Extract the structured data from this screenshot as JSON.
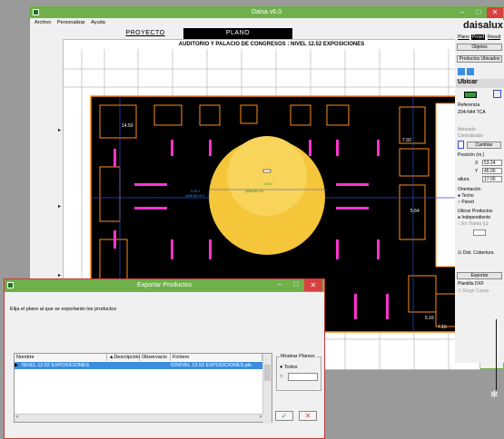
{
  "window": {
    "title": "Daisa v6.0",
    "menu": [
      "Archivo",
      "Personalizar",
      "Ayuda"
    ],
    "tabs": [
      "PROYECTO",
      "PLANO"
    ]
  },
  "drawing": {
    "title": "AUDITORIO Y PALACIO DE CONGRESOS : NIVEL 12.52 EXPOSICIONES",
    "measure_1": "14.50",
    "measure_2": "7.92",
    "measure_3": "5.64",
    "measure_4": "5.16",
    "measure_5": "7.15",
    "circle_label_1": "0.50 t",
    "circle_label_2": "(888.86 m²)",
    "circle_label_3": "1.00 t",
    "circle_label_4": "(888.86 m²)"
  },
  "right_panel": {
    "logo": "daisalux",
    "top_links": [
      "Plano",
      "Proyd",
      "Result"
    ],
    "objetos_btn": "Objetos",
    "productos_btn": "Productos Ubicados",
    "ubicar_title": "Ubicar",
    "referencia_label": "Referencia",
    "referencia_value": "Z04-N44 TCA",
    "adosado_label": "Adosado",
    "centralizado_label": "Centralizado",
    "cambiar_btn": "Cambiar",
    "posicion_label": "Posición (m.)",
    "x_label": "X",
    "x_value": "53.24",
    "y_label": "Y",
    "y_value": "45.00",
    "altura_label": "altura",
    "altura_value": "17.00",
    "orientacion_label": "Orientación",
    "techo_label": "Techo",
    "pared_label": "Pared",
    "ubicar_productos_label": "Ubicar Productos",
    "independiente_label": "Independiente",
    "en_tramo_label": "En Tramo (u)",
    "dist_cobertura_label": "Dist. Cobertura",
    "exportar_btn": "Exportar",
    "plantilla_label": "Plantilla DXF",
    "elegir_capas_label": "Elegir Capas"
  },
  "dialog": {
    "title": "Exportar Productos",
    "prompt": "Elija el plano al que se exportarán los productos",
    "columns": [
      "Nombre",
      "Descripción",
      "Observacio",
      "Fichero"
    ],
    "rows": [
      {
        "nombre": "NIVEL 12.52 EXPOSICIONES",
        "descripcion": "",
        "observacion": "",
        "fichero": "02NIVEL 12.52 EXPOSICIONES.pln"
      }
    ],
    "mostrar_planos_label": "Mostrar Planos:",
    "todos_label": "Todos"
  },
  "colors": {
    "title_green": "#6fb04a",
    "plan_black": "#000000",
    "plan_orange": "#ff8c1a",
    "plan_magenta": "#ff33cc",
    "coverage_yellow": "#f5c53a",
    "selected_blue": "#3b8de0"
  }
}
